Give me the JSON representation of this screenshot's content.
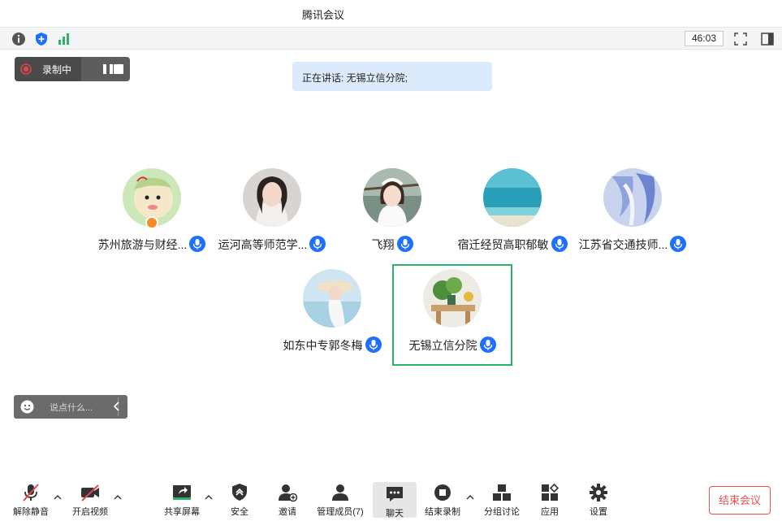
{
  "window": {
    "title": "腾讯会议"
  },
  "topbar": {
    "timer": "46:03"
  },
  "recording": {
    "label": "录制中"
  },
  "speaking": {
    "text": "正在讲话: 无锡立信分院;"
  },
  "participants": [
    {
      "name": "苏州旅游与财经...",
      "host": true
    },
    {
      "name": "运河高等师范学..."
    },
    {
      "name": "飞翔"
    },
    {
      "name": "宿迁经贸高职郁敏"
    },
    {
      "name": "江苏省交通技师..."
    },
    {
      "name": "如东中专郭冬梅"
    },
    {
      "name": "无锡立信分院",
      "active": true
    }
  ],
  "chat": {
    "placeholder": "说点什么..."
  },
  "toolbar": {
    "unmute": "解除静音",
    "video": "开启视频",
    "share": "共享屏幕",
    "security": "安全",
    "invite": "邀请",
    "members": "管理成员(7)",
    "chat": "聊天",
    "stop_record": "结束录制",
    "breakout": "分组讨论",
    "apps": "应用",
    "settings": "设置",
    "end_meeting": "结束会议"
  },
  "colors": {
    "accent": "#1e6fff",
    "active_border": "#2bb36a",
    "end": "#e55252"
  }
}
